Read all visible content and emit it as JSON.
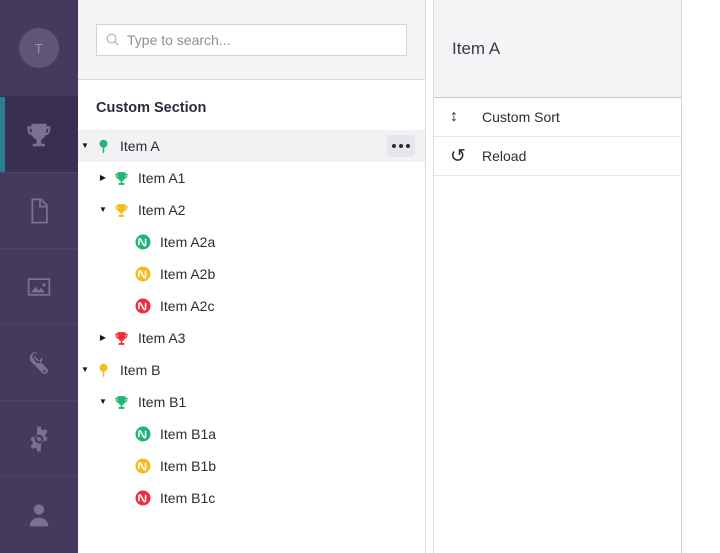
{
  "colors": {
    "rail_bg": "#443a5e",
    "rail_active_bg": "#392f52",
    "rail_accent": "#2a7f8c",
    "green": "#21b573",
    "yellow": "#f5bc20",
    "red": "#ec2e3c",
    "panel_bg": "#f4f4f6",
    "row_selected": "#f2f2f4"
  },
  "rail": {
    "avatar": {
      "initial": "T",
      "icon": "avatar-icon"
    },
    "items": [
      {
        "icon": "trophy-icon",
        "active": true
      },
      {
        "icon": "document-icon",
        "active": false
      },
      {
        "icon": "image-icon",
        "active": false
      },
      {
        "icon": "wrench-icon",
        "active": false
      },
      {
        "icon": "gear-icon",
        "active": false
      },
      {
        "icon": "user-icon",
        "active": false
      }
    ]
  },
  "search": {
    "placeholder": "Type to search...",
    "value": "",
    "icon": "search-icon"
  },
  "tree_panel": {
    "section_title": "Custom Section",
    "rows": [
      {
        "label": "Item A",
        "level": 0,
        "twisty": "expanded",
        "icon": "tree-icon",
        "color": "#21b573",
        "selected": true,
        "menu": true
      },
      {
        "label": "Item A1",
        "level": 1,
        "twisty": "collapsed",
        "icon": "trophy-icon",
        "color": "#21b573",
        "selected": false,
        "menu": false
      },
      {
        "label": "Item A2",
        "level": 1,
        "twisty": "expanded",
        "icon": "trophy-icon",
        "color": "#f5bc20",
        "selected": false,
        "menu": false
      },
      {
        "label": "Item A2a",
        "level": 2,
        "twisty": "none",
        "icon": "wave-circle-icon",
        "color": "#21b573",
        "selected": false,
        "menu": false
      },
      {
        "label": "Item A2b",
        "level": 2,
        "twisty": "none",
        "icon": "wave-circle-icon",
        "color": "#f5bc20",
        "selected": false,
        "menu": false
      },
      {
        "label": "Item A2c",
        "level": 2,
        "twisty": "none",
        "icon": "wave-circle-icon",
        "color": "#ec2e3c",
        "selected": false,
        "menu": false
      },
      {
        "label": "Item A3",
        "level": 1,
        "twisty": "collapsed",
        "icon": "trophy-icon",
        "color": "#ec2e3c",
        "selected": false,
        "menu": false
      },
      {
        "label": "Item B",
        "level": 0,
        "twisty": "expanded",
        "icon": "tree-icon",
        "color": "#f5bc20",
        "selected": false,
        "menu": false
      },
      {
        "label": "Item B1",
        "level": 1,
        "twisty": "expanded",
        "icon": "trophy-icon",
        "color": "#21b573",
        "selected": false,
        "menu": false
      },
      {
        "label": "Item B1a",
        "level": 2,
        "twisty": "none",
        "icon": "wave-circle-icon",
        "color": "#21b573",
        "selected": false,
        "menu": false
      },
      {
        "label": "Item B1b",
        "level": 2,
        "twisty": "none",
        "icon": "wave-circle-icon",
        "color": "#f5bc20",
        "selected": false,
        "menu": false
      },
      {
        "label": "Item B1c",
        "level": 2,
        "twisty": "none",
        "icon": "wave-circle-icon",
        "color": "#ec2e3c",
        "selected": false,
        "menu": false
      }
    ]
  },
  "detail_panel": {
    "title": "Item A",
    "menu_items": [
      {
        "label": "Custom Sort",
        "icon": "updown-arrow-icon"
      },
      {
        "label": "Reload",
        "icon": "undo-arrow-icon"
      }
    ]
  }
}
